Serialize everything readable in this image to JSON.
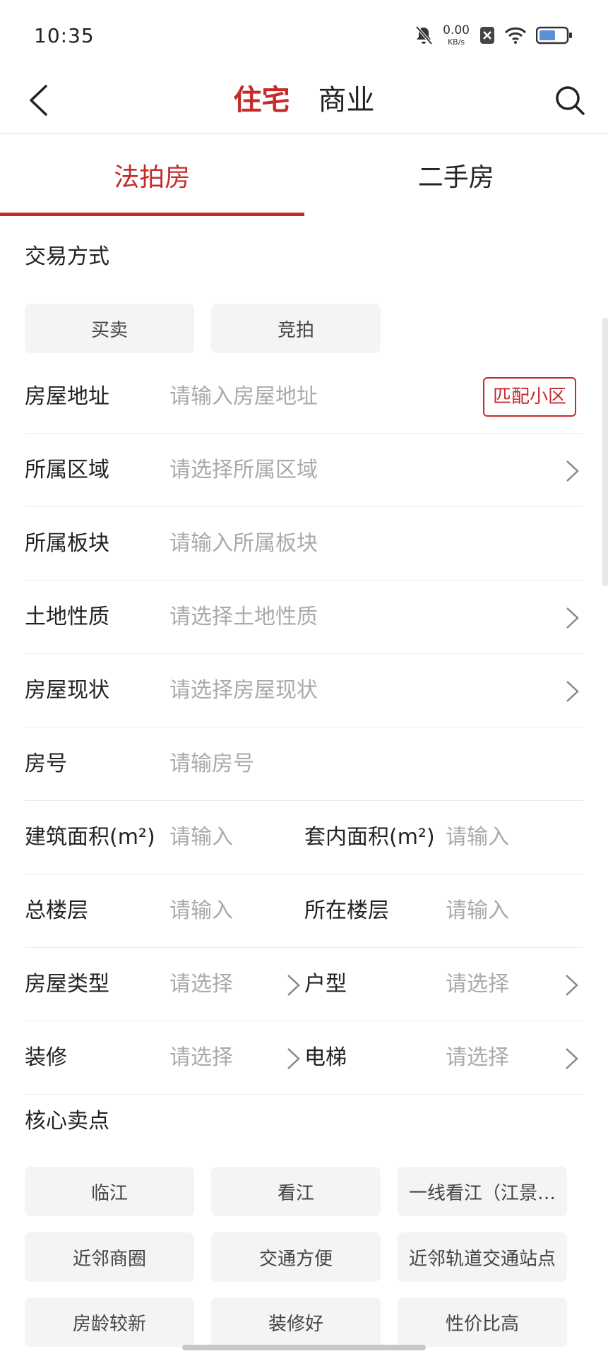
{
  "status": {
    "time": "10:35",
    "net_speed": "0.00",
    "net_unit": "KB/s"
  },
  "nav": {
    "tabs": [
      {
        "label": "住宅"
      },
      {
        "label": "商业"
      }
    ]
  },
  "sub_tabs": [
    {
      "label": "法拍房"
    },
    {
      "label": "二手房"
    }
  ],
  "trade": {
    "title": "交易方式",
    "options": [
      "买卖",
      "竞拍"
    ]
  },
  "form": {
    "address": {
      "label": "房屋地址",
      "placeholder": "请输入房屋地址",
      "match_label": "匹配小区"
    },
    "district": {
      "label": "所属区域",
      "placeholder": "请选择所属区域"
    },
    "block": {
      "label": "所属板块",
      "placeholder": "请输入所属板块"
    },
    "land": {
      "label": "土地性质",
      "placeholder": "请选择土地性质"
    },
    "status": {
      "label": "房屋现状",
      "placeholder": "请选择房屋现状"
    },
    "room_no": {
      "label": "房号",
      "placeholder": "请输房号"
    },
    "build_area": {
      "label": "建筑面积(m²)",
      "placeholder": "请输入"
    },
    "inner_area": {
      "label": "套内面积(m²)",
      "placeholder": "请输入"
    },
    "total_floors": {
      "label": "总楼层",
      "placeholder": "请输入"
    },
    "floor": {
      "label": "所在楼层",
      "placeholder": "请输入"
    },
    "house_type": {
      "label": "房屋类型",
      "placeholder": "请选择"
    },
    "layout": {
      "label": "户型",
      "placeholder": "请选择"
    },
    "decoration": {
      "label": "装修",
      "placeholder": "请选择"
    },
    "elevator": {
      "label": "电梯",
      "placeholder": "请选择"
    }
  },
  "selling_points": {
    "title": "核心卖点",
    "tags": [
      "临江",
      "看江",
      "一线看江（江景…",
      "近邻商圈",
      "交通方便",
      "近邻轨道交通站点",
      "房龄较新",
      "装修好",
      "性价比高"
    ]
  },
  "colors": {
    "accent": "#c62a2a",
    "placeholder": "#aaaaaa",
    "chip_bg": "#f4f4f4"
  }
}
